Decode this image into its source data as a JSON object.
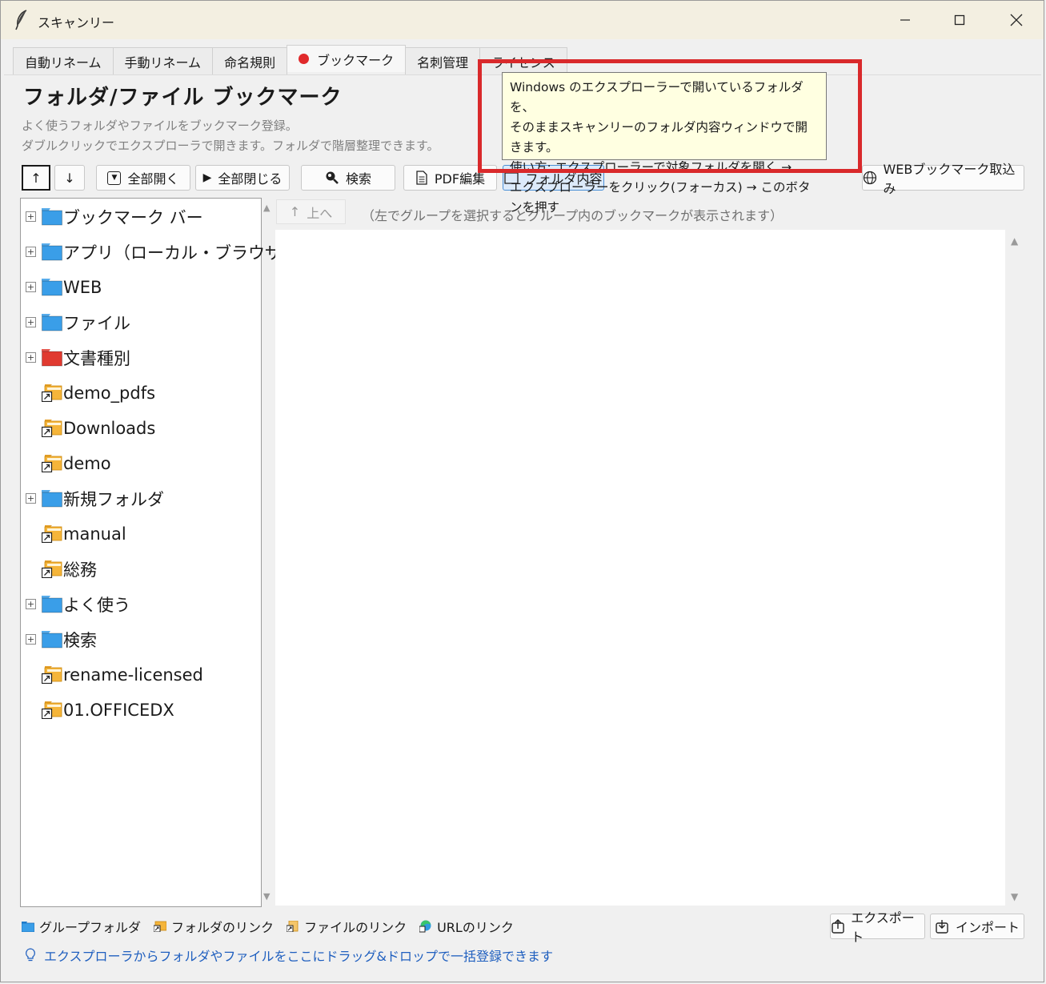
{
  "window": {
    "title": "スキャンリー",
    "minimize": "—",
    "maximize": "☐",
    "close": "✕"
  },
  "tabs": [
    {
      "label": "自動リネーム"
    },
    {
      "label": "手動リネーム"
    },
    {
      "label": "命名規則"
    },
    {
      "label": "ブックマーク",
      "active": true
    },
    {
      "label": "名刺管理"
    },
    {
      "label": "ライセンス"
    }
  ],
  "header": {
    "title": "フォルダ/ファイル ブックマーク",
    "desc1": "よく使うフォルダやファイルをブックマーク登録。",
    "desc2": "ダブルクリックでエクスプローラで開きます。フォルダで階層整理できます。"
  },
  "toolbar": {
    "up": "↑",
    "down": "↓",
    "expand_all": "全部開く",
    "collapse_all": "全部閉じる",
    "search": "検索",
    "pdf_edit": "PDF編集",
    "folder_contents": "フォルダ内容",
    "web_import": "WEBブックマーク取込み"
  },
  "tree": [
    {
      "label": "ブックマーク バー",
      "type": "group",
      "color": "#3a9ee8",
      "expandable": true
    },
    {
      "label": "アプリ（ローカル・ブラウザ）",
      "type": "group",
      "color": "#3a9ee8",
      "expandable": true
    },
    {
      "label": "WEB",
      "type": "group",
      "color": "#3a9ee8",
      "expandable": true
    },
    {
      "label": "ファイル",
      "type": "group",
      "color": "#3a9ee8",
      "expandable": true
    },
    {
      "label": "文書種別",
      "type": "group",
      "color": "#e03a30",
      "expandable": true
    },
    {
      "label": "demo_pdfs",
      "type": "link"
    },
    {
      "label": "Downloads",
      "type": "link"
    },
    {
      "label": "demo",
      "type": "link"
    },
    {
      "label": "新規フォルダ",
      "type": "group",
      "color": "#3a9ee8",
      "expandable": true
    },
    {
      "label": "manual",
      "type": "link"
    },
    {
      "label": "総務",
      "type": "link"
    },
    {
      "label": "よく使う",
      "type": "group",
      "color": "#3a9ee8",
      "expandable": true
    },
    {
      "label": "検索",
      "type": "group",
      "color": "#3a9ee8",
      "expandable": true
    },
    {
      "label": "rename-licensed",
      "type": "link"
    },
    {
      "label": "01.OFFICEDX",
      "type": "link"
    }
  ],
  "right": {
    "up_button": "上へ",
    "hint": "（左でグループを選択するとグループ内のブックマークが表示されます）"
  },
  "tooltip": {
    "line1": "Windows のエクスプローラーで開いているフォルダを、",
    "line2": "そのままスキャンリーのフォルダ内容ウィンドウで開きます。",
    "line3": "使い方: エクスプローラーで対象フォルダを開く →",
    "line4": "エクスプローラーをクリック(フォーカス) → このボタンを押す"
  },
  "legend": {
    "group_folder": "グループフォルダ",
    "folder_link": "フォルダのリンク",
    "file_link": "ファイルのリンク",
    "url_link": "URLのリンク"
  },
  "bottom": {
    "hint": "エクスプローラからフォルダやファイルをここにドラッグ&ドロップで一括登録できます",
    "export": "エクスポート",
    "import": "インポート"
  },
  "colors": {
    "accent_red": "#d9292b",
    "group_blue": "#3a9ee8",
    "link_orange": "#f5b53a",
    "hint_blue": "#1f5fbf"
  }
}
